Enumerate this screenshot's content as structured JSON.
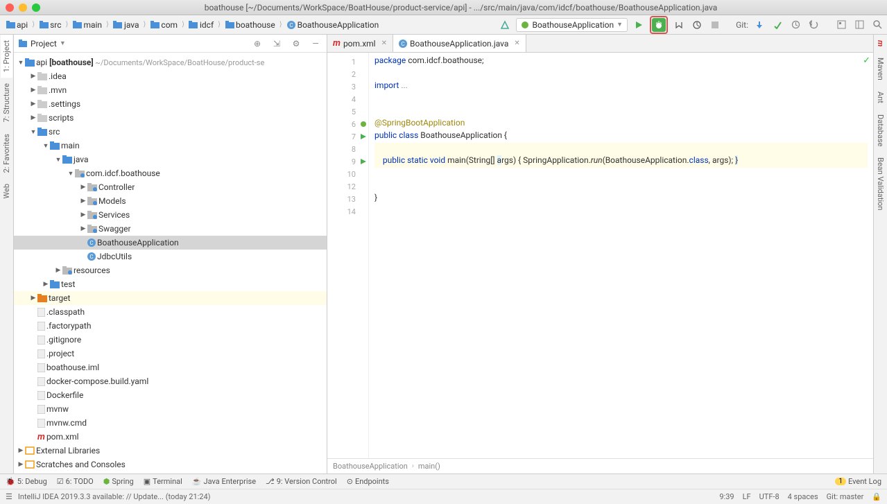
{
  "window_title": "boathouse [~/Documents/WorkSpace/BoatHouse/product-service/api] - .../src/main/java/com/idcf/boathouse/BoathouseApplication.java",
  "breadcrumbs": [
    "api",
    "src",
    "main",
    "java",
    "com",
    "idcf",
    "boathouse",
    "BoathouseApplication"
  ],
  "run_config": "BoathouseApplication",
  "git_label": "Git:",
  "project_header": "Project",
  "tree": {
    "root_name": "api",
    "root_bold": "[boathouse]",
    "root_path": "~/Documents/WorkSpace/BoatHouse/product-se",
    "nodes": [
      {
        "d": 1,
        "i": "fold",
        "l": ".idea",
        "a": "▶"
      },
      {
        "d": 1,
        "i": "fold",
        "l": ".mvn",
        "a": "▶"
      },
      {
        "d": 1,
        "i": "fold",
        "l": ".settings",
        "a": "▶"
      },
      {
        "d": 1,
        "i": "fold",
        "l": "scripts",
        "a": "▶"
      },
      {
        "d": 1,
        "i": "foldb",
        "l": "src",
        "a": "▼"
      },
      {
        "d": 2,
        "i": "foldb",
        "l": "main",
        "a": "▼"
      },
      {
        "d": 3,
        "i": "foldb",
        "l": "java",
        "a": "▼"
      },
      {
        "d": 4,
        "i": "foldg",
        "l": "com.idcf.boathouse",
        "a": "▼"
      },
      {
        "d": 5,
        "i": "foldg",
        "l": "Controller",
        "a": "▶"
      },
      {
        "d": 5,
        "i": "foldg",
        "l": "Models",
        "a": "▶"
      },
      {
        "d": 5,
        "i": "foldg",
        "l": "Services",
        "a": "▶"
      },
      {
        "d": 5,
        "i": "foldg",
        "l": "Swagger",
        "a": "▶"
      },
      {
        "d": 5,
        "i": "cfile",
        "l": "BoathouseApplication",
        "sel": true
      },
      {
        "d": 5,
        "i": "cfile",
        "l": "JdbcUtils"
      },
      {
        "d": 3,
        "i": "foldg",
        "l": "resources",
        "a": "▶"
      },
      {
        "d": 2,
        "i": "foldb",
        "l": "test",
        "a": "▶"
      },
      {
        "d": 1,
        "i": "foldo",
        "l": "target",
        "a": "▶",
        "hl": true
      },
      {
        "d": 1,
        "i": "file",
        "l": ".classpath"
      },
      {
        "d": 1,
        "i": "file",
        "l": ".factorypath"
      },
      {
        "d": 1,
        "i": "file",
        "l": ".gitignore"
      },
      {
        "d": 1,
        "i": "file",
        "l": ".project"
      },
      {
        "d": 1,
        "i": "file",
        "l": "boathouse.iml"
      },
      {
        "d": 1,
        "i": "file",
        "l": "docker-compose.build.yaml"
      },
      {
        "d": 1,
        "i": "file",
        "l": "Dockerfile"
      },
      {
        "d": 1,
        "i": "file",
        "l": "mvnw"
      },
      {
        "d": 1,
        "i": "file",
        "l": "mvnw.cmd"
      },
      {
        "d": 1,
        "i": "mvn",
        "l": "pom.xml"
      }
    ],
    "ext_lib": "External Libraries",
    "scratches": "Scratches and Consoles"
  },
  "tabs": [
    {
      "icon": "mvn",
      "label": "pom.xml",
      "active": false
    },
    {
      "icon": "cfile",
      "label": "BoathouseApplication.java",
      "active": true
    }
  ],
  "code": {
    "lines": [
      1,
      2,
      3,
      4,
      5,
      6,
      7,
      8,
      9,
      10,
      12,
      13,
      14
    ],
    "l1": "package com.idcf.boathouse;",
    "l3": "import ...",
    "l6": "@SpringBootApplication",
    "l7_a": "public class ",
    "l7_b": "BoathouseApplication {",
    "l9_a": "    public static void ",
    "l9_b": "main",
    "l9_c": "(String[] ",
    "l9_d": "args",
    "l9_e": ") { SpringApplication.",
    "l9_f": "run",
    "l9_g": "(BoathouseApplication.",
    "l9_h": "class",
    "l9_i": ", args); }",
    "l13": "}"
  },
  "editor_crumb": [
    "BoathouseApplication",
    "main()"
  ],
  "left_tabs": [
    "1: Project",
    "7: Structure",
    "2: Favorites",
    "Web"
  ],
  "right_tabs": [
    "Maven",
    "Ant",
    "Database",
    "Bean Validation"
  ],
  "bottom_tabs": [
    "5: Debug",
    "6: TODO",
    "Spring",
    "Terminal",
    "Java Enterprise",
    "9: Version Control",
    "Endpoints"
  ],
  "event_log": "Event Log",
  "status_msg": "IntelliJ IDEA 2019.3.3 available: // Update... (today 21:24)",
  "status_right": {
    "pos": "9:39",
    "sep": "LF",
    "enc": "UTF-8",
    "indent": "4 spaces",
    "branch": "Git: master"
  }
}
